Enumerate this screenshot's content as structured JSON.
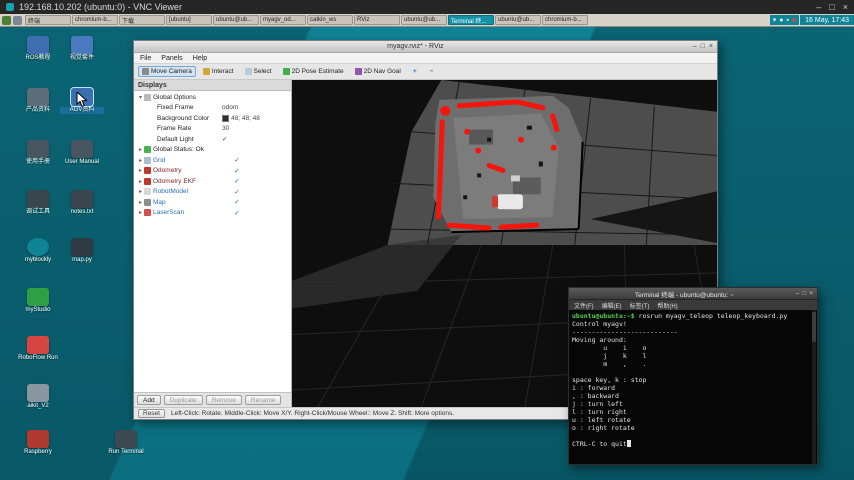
{
  "vnc": {
    "title": "192.168.10.202 (ubuntu:0) - VNC Viewer",
    "controls": [
      {
        "g": "–",
        "name": "minimize-button"
      },
      {
        "g": "□",
        "name": "maximize-button"
      },
      {
        "g": "×",
        "name": "close-button"
      }
    ]
  },
  "taskbar": {
    "buttons": [
      {
        "label": "终端"
      },
      {
        "label": "chromium-b..."
      },
      {
        "label": "下载"
      },
      {
        "label": "[ubuntu]"
      },
      {
        "label": "ubuntu@ub..."
      },
      {
        "label": "myagv_od..."
      },
      {
        "label": "catkin_ws"
      },
      {
        "label": "RViz"
      },
      {
        "label": "ubuntu@ub..."
      },
      {
        "label": "Terminal 终...",
        "cls": "active"
      },
      {
        "label": "ubuntu@ub..."
      },
      {
        "label": "chromium-b..."
      }
    ],
    "tray": [
      {
        "g": "▾",
        "name": "network-icon"
      },
      {
        "g": "●",
        "name": "volume-icon"
      },
      {
        "g": "▪",
        "name": "notification-icon"
      },
      {
        "g": "■",
        "name": "record-icon",
        "style": "color:#d24a3c"
      }
    ],
    "clock": "16 May, 17:43"
  },
  "desktop": {
    "icons": [
      {
        "style": "left:16px;top:22px",
        "iconStyle": "background:#3f6db2",
        "label": "ROS教程"
      },
      {
        "style": "left:60px;top:22px",
        "iconStyle": "background:#4a79c0",
        "label": "视觉套件"
      },
      {
        "style": "left:16px;top:74px",
        "iconStyle": "background:#5d6d7a",
        "label": "产品资料"
      },
      {
        "style": "left:60px;top:74px",
        "iconStyle": "background:#3a6fb0",
        "label": "AGV资料",
        "cls": "selected"
      },
      {
        "style": "left:16px;top:126px",
        "iconStyle": "background:#46555f",
        "label": "使用手册"
      },
      {
        "style": "left:60px;top:126px",
        "iconStyle": "background:#46555f",
        "label": "User Manual"
      },
      {
        "style": "left:16px;top:176px",
        "iconStyle": "background:#39464e",
        "label": "调试工具"
      },
      {
        "style": "left:60px;top:176px",
        "iconStyle": "background:#39464e",
        "label": "notes.txt"
      },
      {
        "style": "left:16px;top:224px",
        "iconStyle": "background:#0f8496;border-radius:50%",
        "label": "myblockly"
      },
      {
        "style": "left:60px;top:224px",
        "iconStyle": "background:#2f3b42",
        "label": "map.py"
      },
      {
        "style": "left:16px;top:274px",
        "iconStyle": "background:#2f9e44",
        "label": "myStudio"
      },
      {
        "style": "left:16px;top:322px",
        "iconStyle": "background:#d64541",
        "label": "RoboFlow Run"
      },
      {
        "style": "left:16px;top:370px",
        "iconStyle": "background:#8a97a0",
        "label": "aikit_V2"
      },
      {
        "style": "left:16px;top:416px",
        "iconStyle": "background:#b03a30",
        "label": "Raspberry"
      },
      {
        "style": "left:104px;top:416px",
        "iconStyle": "background:#3e4a52",
        "label": "Run Terminal"
      }
    ]
  },
  "rviz": {
    "title": "myagv.rviz* - RViz",
    "controls": [
      {
        "g": "–",
        "name": "minimize-button"
      },
      {
        "g": "□",
        "name": "maximize-button"
      },
      {
        "g": "×",
        "name": "close-button"
      }
    ],
    "menus": [
      {
        "label": "File",
        "name": "menu-file"
      },
      {
        "label": "Panels",
        "name": "menu-panels"
      },
      {
        "label": "Help",
        "name": "menu-help"
      }
    ],
    "tools": [
      {
        "label": "Move Camera",
        "cls": "active",
        "name": "tool-move-camera",
        "iconStyle": "display:inline-block;background:#8a8a8a"
      },
      {
        "label": "Interact",
        "name": "tool-interact",
        "iconStyle": "display:inline-block;background:#d2a63c"
      },
      {
        "label": "Select",
        "name": "tool-select",
        "iconStyle": "display:inline-block;background:#b7c9da"
      },
      {
        "label": "2D Pose Estimate",
        "name": "tool-2d-pose-estimate",
        "iconStyle": "display:inline-block;background:#3fae4e"
      },
      {
        "label": "2D Nav Goal",
        "name": "tool-2d-nav-goal",
        "iconStyle": "display:inline-block;background:#9354b5"
      },
      {
        "label": "+",
        "cls": "mini",
        "name": "add-tool-button"
      },
      {
        "label": "−",
        "cls": "mini",
        "name": "remove-tool-button"
      }
    ],
    "panel_title": "Displays",
    "displays": [
      {
        "exp": "▾",
        "name": "Global Options",
        "rowStyle": "padding-left:3px",
        "iconStyle": "display:inline-block;background:#b9b9b9"
      },
      {
        "name": "Fixed Frame",
        "value": "odom",
        "rowStyle": "padding-left:16px"
      },
      {
        "name": "Background Color",
        "value": "48; 48; 48",
        "rowStyle": "padding-left:16px",
        "swatchStyle": "display:inline-block;background:#303030"
      },
      {
        "name": "Frame Rate",
        "value": "30",
        "rowStyle": "padding-left:16px"
      },
      {
        "name": "Default Light",
        "value": "✓",
        "rowStyle": "padding-left:16px"
      },
      {
        "exp": "▸",
        "name": "Global Status: Ok",
        "rowStyle": "padding-left:3px",
        "iconStyle": "display:inline-block;background:#49b24f"
      },
      {
        "exp": "▸",
        "name": "Grid",
        "check": "✓",
        "rowStyle": "padding-left:3px",
        "iconStyle": "display:inline-block;background:#a9bfd0",
        "nameStyle": "color:#2a6fb0"
      },
      {
        "exp": "▸",
        "name": "Odometry",
        "check": "✓",
        "rowStyle": "padding-left:3px",
        "iconStyle": "display:inline-block;background:#c0392b",
        "nameStyle": "color:#7a1f1f"
      },
      {
        "exp": "▸",
        "name": "Odometry EKF",
        "check": "✓",
        "rowStyle": "padding-left:3px",
        "iconStyle": "display:inline-block;background:#c0392b",
        "nameStyle": "color:#7a1f1f"
      },
      {
        "exp": "▸",
        "name": "RobotModel",
        "check": "✓",
        "rowStyle": "padding-left:3px",
        "iconStyle": "display:inline-block;background:#d8d8d8",
        "nameStyle": "color:#2a6fb0"
      },
      {
        "exp": "▸",
        "name": "Map",
        "check": "✓",
        "rowStyle": "padding-left:3px",
        "iconStyle": "display:inline-block;background:#8d8d8d",
        "nameStyle": "color:#2a6fb0"
      },
      {
        "exp": "▸",
        "name": "LaserScan",
        "check": "✓",
        "rowStyle": "padding-left:3px",
        "iconStyle": "display:inline-block;background:#d4504a",
        "nameStyle": "color:#2a6fb0"
      }
    ],
    "panel_buttons": [
      {
        "label": "Add",
        "name": "add-display-button"
      },
      {
        "label": "Duplicate",
        "cls": "disabled",
        "name": "duplicate-display-button"
      },
      {
        "label": "Remove",
        "cls": "disabled",
        "name": "remove-display-button"
      },
      {
        "label": "Rename",
        "cls": "disabled",
        "name": "rename-display-button"
      }
    ],
    "reset_label": "Reset",
    "status": "Left-Click: Rotate.  Middle-Click: Move X/Y.  Right-Click/Mouse Wheel:: Move Z.  Shift: More options."
  },
  "terminal": {
    "title": "Terminal 终端 - ubuntu@ubuntu: ~",
    "controls": [
      {
        "g": "–",
        "name": "minimize-button"
      },
      {
        "g": "□",
        "name": "maximize-button"
      },
      {
        "g": "×",
        "name": "close-button"
      }
    ],
    "menus": [
      {
        "label": "文件(F)",
        "name": "menu-file"
      },
      {
        "label": "编辑(E)",
        "name": "menu-edit"
      },
      {
        "label": "标签(T)",
        "name": "menu-tabs"
      },
      {
        "label": "帮助(H)",
        "name": "menu-help"
      }
    ],
    "lines": [
      {
        "pre": "ubuntu@ubuntu:~$",
        "t": " rosrun myagv_teleop teleop_keyboard.py"
      },
      {
        "t": "Control myagv!"
      },
      {
        "t": "---------------------------"
      },
      {
        "t": "Moving around:"
      },
      {
        "t": "        u    i    o"
      },
      {
        "t": "        j    k    l"
      },
      {
        "t": "        m    ,    ."
      },
      {
        "t": " "
      },
      {
        "t": "space key, k : stop"
      },
      {
        "t": "i : forward"
      },
      {
        "t": ", : backward"
      },
      {
        "t": "j : turn left"
      },
      {
        "t": "l : turn right"
      },
      {
        "t": "u : left rotate"
      },
      {
        "t": "o : right rotate"
      },
      {
        "t": " "
      },
      {
        "t": "CTRL-C to quit",
        "cursorStyle": "display:inline-block"
      }
    ]
  }
}
